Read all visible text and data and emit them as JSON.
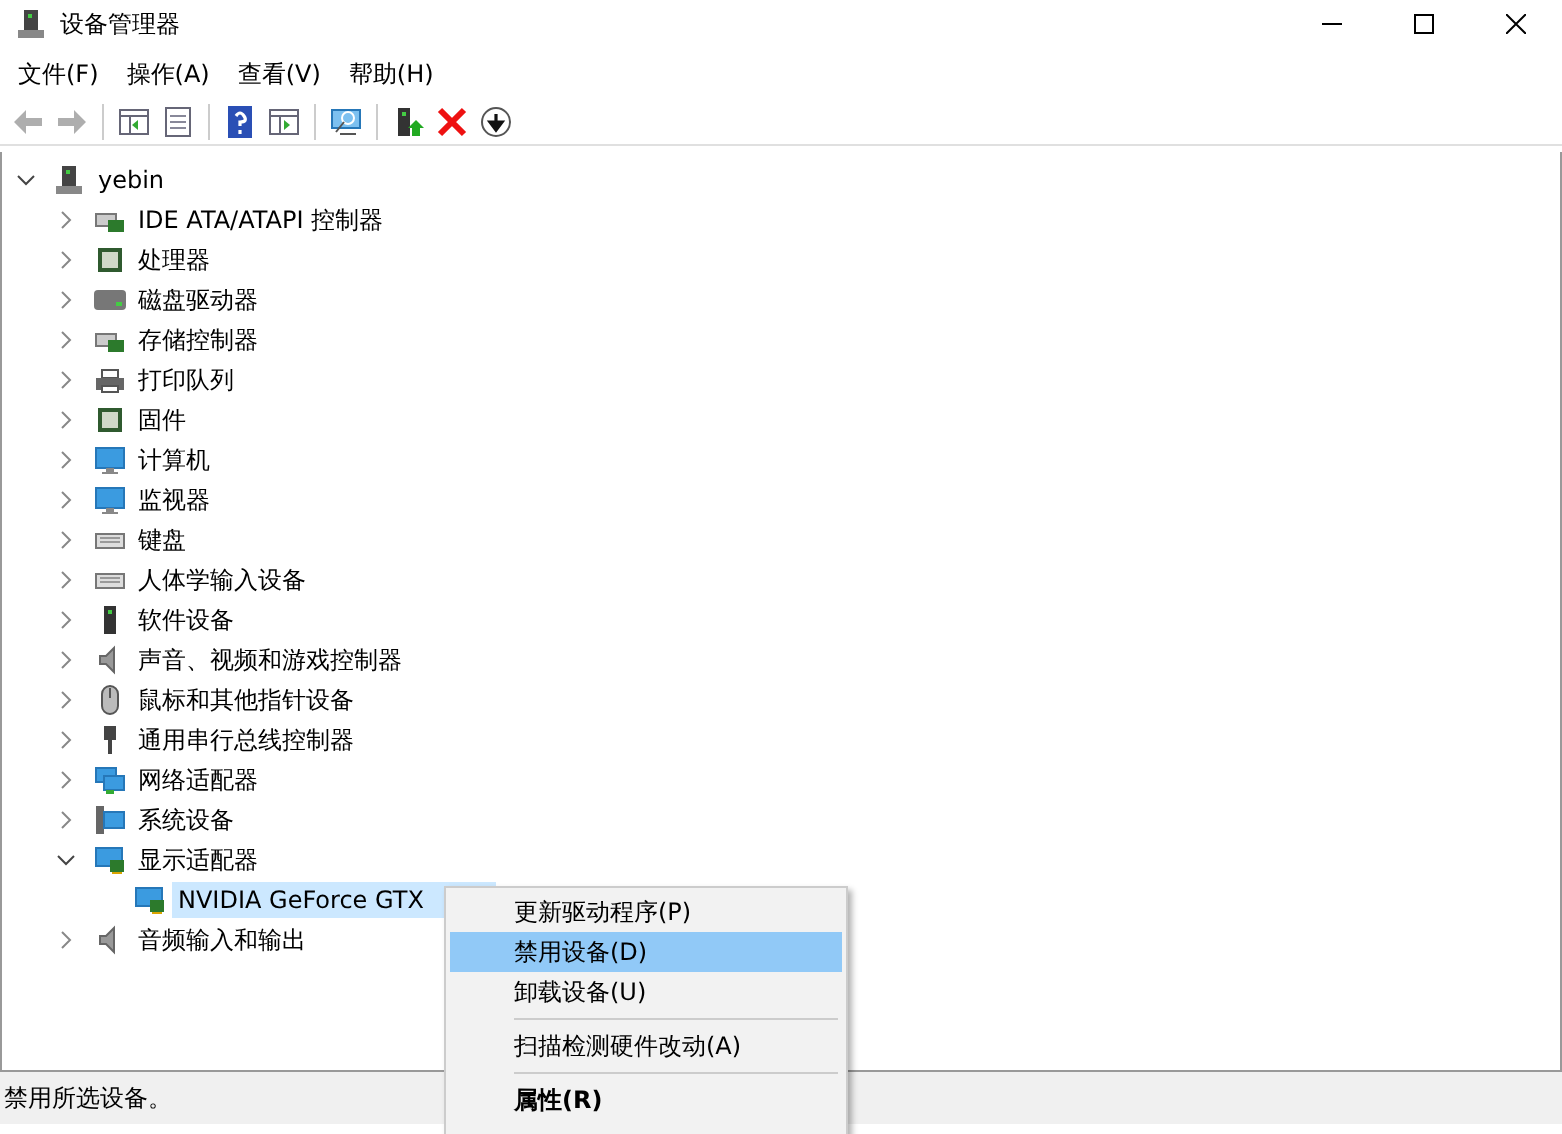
{
  "window": {
    "title": "设备管理器"
  },
  "menu_bar": [
    "文件(F)",
    "操作(A)",
    "查看(V)",
    "帮助(H)"
  ],
  "toolbar": [
    {
      "disabled": true
    },
    {
      "disabled": true
    },
    {
      "disabled": false
    },
    {
      "disabled": false
    },
    {
      "disabled": false
    },
    {
      "disabled": false
    },
    {
      "disabled": false
    },
    {
      "disabled": false
    },
    {
      "disabled": false
    },
    {
      "disabled": false
    }
  ],
  "tree": {
    "label": "yebin",
    "expanded": true,
    "selected": false,
    "children": [
      {
        "label": "IDE ATA/ATAPI 控制器",
        "expanded": false,
        "selected": false
      },
      {
        "label": "处理器",
        "expanded": false,
        "selected": false
      },
      {
        "label": "磁盘驱动器",
        "expanded": false,
        "selected": false
      },
      {
        "label": "存储控制器",
        "expanded": false,
        "selected": false
      },
      {
        "label": "打印队列",
        "expanded": false,
        "selected": false
      },
      {
        "label": "固件",
        "expanded": false,
        "selected": false
      },
      {
        "label": "计算机",
        "expanded": false,
        "selected": false
      },
      {
        "label": "监视器",
        "expanded": false,
        "selected": false
      },
      {
        "label": "键盘",
        "expanded": false,
        "selected": false
      },
      {
        "label": "人体学输入设备",
        "expanded": false,
        "selected": false
      },
      {
        "label": "软件设备",
        "expanded": false,
        "selected": false
      },
      {
        "label": "声音、视频和游戏控制器",
        "expanded": false,
        "selected": false
      },
      {
        "label": "鼠标和其他指针设备",
        "expanded": false,
        "selected": false
      },
      {
        "label": "通用串行总线控制器",
        "expanded": false,
        "selected": false
      },
      {
        "label": "网络适配器",
        "expanded": false,
        "selected": false
      },
      {
        "label": "系统设备",
        "expanded": false,
        "selected": false
      },
      {
        "label": "显示适配器",
        "expanded": true,
        "selected": false,
        "children": [
          {
            "label": "NVIDIA GeForce GTX",
            "selected": true
          }
        ]
      },
      {
        "label": "音频输入和输出",
        "expanded": false,
        "selected": false
      }
    ]
  },
  "context_menu": [
    {
      "kind": "item",
      "label": "更新驱动程序(P)",
      "selected": false,
      "default": false
    },
    {
      "kind": "item",
      "label": "禁用设备(D)",
      "selected": true,
      "default": false
    },
    {
      "kind": "item",
      "label": "卸载设备(U)",
      "selected": false,
      "default": false
    },
    {
      "kind": "separator"
    },
    {
      "kind": "item",
      "label": "扫描检测硬件改动(A)",
      "selected": false,
      "default": false
    },
    {
      "kind": "separator"
    },
    {
      "kind": "item",
      "label": "属性(R)",
      "selected": false,
      "default": true
    }
  ],
  "status_bar": "禁用所选设备。"
}
